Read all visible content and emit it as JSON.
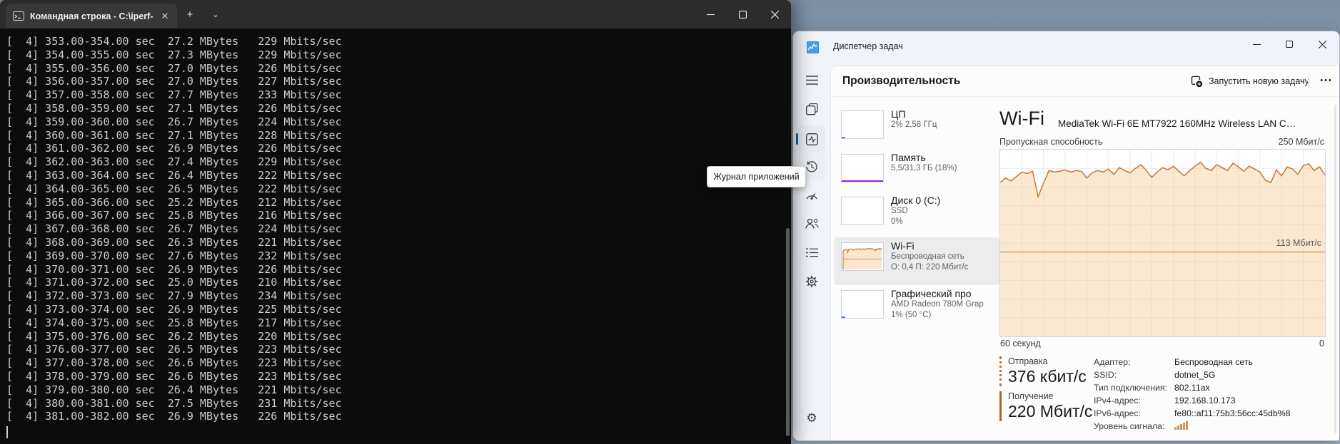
{
  "colors": {
    "accent_blue": "#0067c0",
    "wifi_line": "#c9752f",
    "wifi_fill": "#f6c890",
    "send_border": "#c9752f",
    "recv_border": "#b5621b",
    "mem_accent": "#9b27c8",
    "cpu_accent": "#4f7ecc",
    "signal": "#c79a5e",
    "term_bg": "#0c0c0c",
    "term_text": "#cccccc",
    "tab_bar": "#2c2c2c",
    "tab_bg": "#383838",
    "tm_bg": "#f0f3f9",
    "panel_bg": "#fcfcfd",
    "desktop_top": "#7b90a5",
    "desktop_bottom": "#a7bccf"
  },
  "terminal": {
    "tab_title": "Командная строка - C:\\iperf-",
    "tab_close_glyph": "✕",
    "new_tab_glyph": "+",
    "chevron_glyph": "⌄",
    "lines": [
      "[  4] 353.00-354.00 sec  27.2 MBytes   229 Mbits/sec",
      "[  4] 354.00-355.00 sec  27.3 MBytes   229 Mbits/sec",
      "[  4] 355.00-356.00 sec  27.0 MBytes   226 Mbits/sec",
      "[  4] 356.00-357.00 sec  27.0 MBytes   227 Mbits/sec",
      "[  4] 357.00-358.00 sec  27.7 MBytes   233 Mbits/sec",
      "[  4] 358.00-359.00 sec  27.1 MBytes   226 Mbits/sec",
      "[  4] 359.00-360.00 sec  26.7 MBytes   224 Mbits/sec",
      "[  4] 360.00-361.00 sec  27.1 MBytes   228 Mbits/sec",
      "[  4] 361.00-362.00 sec  26.9 MBytes   226 Mbits/sec",
      "[  4] 362.00-363.00 sec  27.4 MBytes   229 Mbits/sec",
      "[  4] 363.00-364.00 sec  26.4 MBytes   222 Mbits/sec",
      "[  4] 364.00-365.00 sec  26.5 MBytes   222 Mbits/sec",
      "[  4] 365.00-366.00 sec  25.2 MBytes   212 Mbits/sec",
      "[  4] 366.00-367.00 sec  25.8 MBytes   216 Mbits/sec",
      "[  4] 367.00-368.00 sec  26.7 MBytes   224 Mbits/sec",
      "[  4] 368.00-369.00 sec  26.3 MBytes   221 Mbits/sec",
      "[  4] 369.00-370.00 sec  27.6 MBytes   232 Mbits/sec",
      "[  4] 370.00-371.00 sec  26.9 MBytes   226 Mbits/sec",
      "[  4] 371.00-372.00 sec  25.0 MBytes   210 Mbits/sec",
      "[  4] 372.00-373.00 sec  27.9 MBytes   234 Mbits/sec",
      "[  4] 373.00-374.00 sec  26.9 MBytes   225 Mbits/sec",
      "[  4] 374.00-375.00 sec  25.8 MBytes   217 Mbits/sec",
      "[  4] 375.00-376.00 sec  26.2 MBytes   220 Mbits/sec",
      "[  4] 376.00-377.00 sec  26.5 MBytes   223 Mbits/sec",
      "[  4] 377.00-378.00 sec  26.6 MBytes   223 Mbits/sec",
      "[  4] 378.00-379.00 sec  26.6 MBytes   223 Mbits/sec",
      "[  4] 379.00-380.00 sec  26.4 MBytes   221 Mbits/sec",
      "[  4] 380.00-381.00 sec  27.5 MBytes   231 Mbits/sec",
      "[  4] 381.00-382.00 sec  26.9 MBytes   226 Mbits/sec"
    ]
  },
  "task_manager": {
    "window_title": "Диспетчер задач",
    "page_title": "Производительность",
    "run_task_label": "Запустить новую задачу",
    "ellipsis_glyph": "•••",
    "tooltip_text": "Журнал приложений",
    "settings_glyph": "⚙",
    "nav_icons": [
      "hamburger-icon",
      "processes-icon",
      "performance-icon",
      "history-icon",
      "startup-apps-icon",
      "users-icon",
      "details-icon",
      "services-icon",
      "settings-gear-icon"
    ],
    "perf_items": [
      {
        "kind": "cpu",
        "name": "ЦП",
        "sub1": "2%  2,58 ГГц",
        "sub2": "",
        "selected": false
      },
      {
        "kind": "mem",
        "name": "Память",
        "sub1": "5,5/31,3 ГБ (18%)",
        "sub2": "",
        "selected": false
      },
      {
        "kind": "disk",
        "name": "Диск 0 (C:)",
        "sub1": "SSD",
        "sub2": "0%",
        "selected": false
      },
      {
        "kind": "wifi",
        "name": "Wi-Fi",
        "sub1": "Беспроводная сеть",
        "sub2": "О: 0,4 П: 220 Мбит/с",
        "selected": true
      },
      {
        "kind": "gpu",
        "name": "Графический про",
        "sub1": "AMD Radeon 780M Grap",
        "sub2": "1% (50 °C)",
        "selected": false
      }
    ],
    "wifi": {
      "title": "Wi-Fi",
      "subtitle": "MediaTek Wi-Fi 6E MT7922 160MHz Wireless LAN C…",
      "chart_caption": "Пропускная способность",
      "chart_max_label": "250 Мбит/с",
      "ref_label": "113 Мбит/с",
      "x_left_label": "60 секунд",
      "x_right_label": "0",
      "send_label": "Отправка",
      "send_value": "376 кбит/с",
      "recv_label": "Получение",
      "recv_value": "220 Мбит/с",
      "details": [
        {
          "label": "Адаптер:",
          "value": "Беспроводная сеть",
          "signal": false
        },
        {
          "label": "SSID:",
          "value": "dotnet_5G",
          "signal": false
        },
        {
          "label": "Тип подключения:",
          "value": "802.11ax",
          "signal": false
        },
        {
          "label": "IPv4-адрес:",
          "value": "192.168.10.173",
          "signal": false
        },
        {
          "label": "IPv6-адрес:",
          "value": "fe80::af11:75b3:56cc:45db%8",
          "signal": false
        },
        {
          "label": "Уровень сигнала:",
          "value": "",
          "signal": true
        }
      ]
    }
  },
  "chart_data": {
    "type": "area",
    "title": "Пропускная способность",
    "xlabel": "",
    "ylabel": "Мбит/с",
    "ylim": [
      0,
      250
    ],
    "y_max_label": "250 Мбит/с",
    "x_axis": {
      "left_label": "60 секунд",
      "right_label": "0",
      "span_seconds": 60
    },
    "grid": true,
    "legend": "none",
    "reference_line": {
      "value": 113,
      "label": "113 Мбит/с"
    },
    "series": [
      {
        "name": "Получение (Мбит/с)",
        "color": "#c9752f",
        "fill": "#f6c890",
        "values": [
          206,
          212,
          208,
          214,
          220,
          218,
          221,
          187,
          205,
          222,
          220,
          221,
          223,
          220,
          222,
          221,
          212,
          219,
          222,
          220,
          224,
          217,
          226,
          222,
          219,
          225,
          230,
          222,
          213,
          220,
          226,
          223,
          228,
          221,
          215,
          222,
          228,
          233,
          225,
          222,
          230,
          226,
          222,
          232,
          227,
          221,
          228,
          224,
          220,
          209,
          206,
          223,
          215,
          227,
          224,
          217,
          229,
          231,
          222,
          227,
          216
        ]
      }
    ]
  }
}
